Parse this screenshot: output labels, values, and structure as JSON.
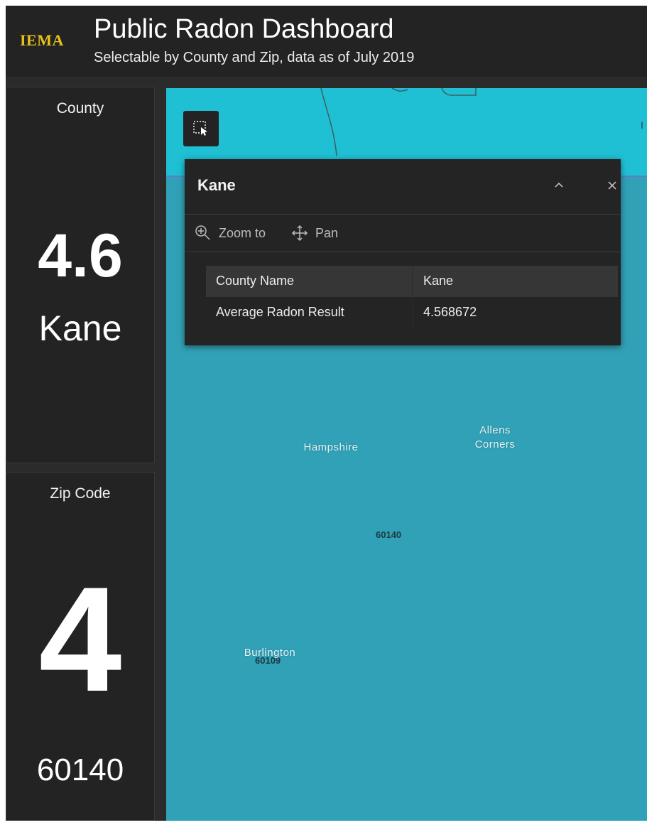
{
  "header": {
    "logo_text": "IEMA",
    "title": "Public Radon Dashboard",
    "subtitle": "Selectable by County and Zip, data as of July 2019"
  },
  "county_panel": {
    "title": "County",
    "value": "4.6",
    "name": "Kane"
  },
  "zip_panel": {
    "title": "Zip Code",
    "value": "4",
    "name": "60140"
  },
  "map": {
    "select_tool_icon": "select-rectangle-icon",
    "edge_label": "I",
    "place_labels": [
      {
        "text": "Hampshire"
      },
      {
        "text": "Allens\nCorners"
      },
      {
        "text": "Burlington"
      }
    ],
    "zip_labels": [
      "60140",
      "60109"
    ],
    "colors": {
      "water_top": "#1fc0d4",
      "water": "#31a1b7"
    }
  },
  "popup": {
    "title": "Kane",
    "collapse_icon": "chevron-up-icon",
    "close_icon": "close-icon",
    "actions": [
      {
        "label": "Zoom to",
        "icon": "zoom-in-icon"
      },
      {
        "label": "Pan",
        "icon": "pan-icon"
      }
    ],
    "attributes": [
      {
        "key": "County Name",
        "value": "Kane"
      },
      {
        "key": "Average Radon Result",
        "value": "4.568672"
      }
    ]
  }
}
